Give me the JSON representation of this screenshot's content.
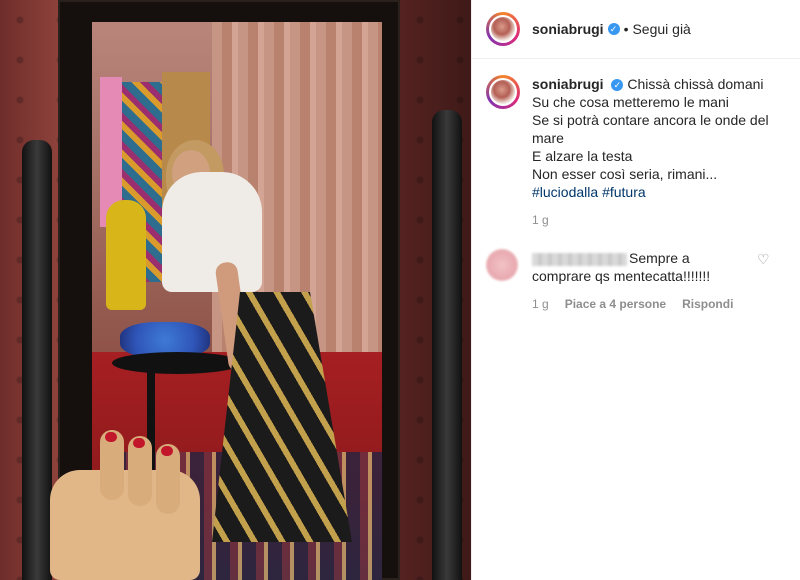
{
  "post": {
    "username": "soniabrugi",
    "verified_badge": "✓",
    "separator": "•",
    "follow_label": "Segui già",
    "caption_lines": [
      "Chissà chissà domani",
      "Su che cosa metteremo le mani",
      "Se si potrà contare ancora le onde del mare",
      "E alzare la testa",
      "Non esser così seria, rimani..."
    ],
    "hashtags": [
      "#luciodalla",
      "#futura"
    ],
    "time": "1 g"
  },
  "comment": {
    "text": "Sempre a comprare qs mentecatta!!!!!!!",
    "time": "1 g",
    "likes": "Piace a 4 persone",
    "reply": "Rispondi",
    "heart_icon": "♡"
  },
  "colors": {
    "link": "#00376b",
    "verified": "#3897f0",
    "muted": "#8e8e8e"
  }
}
